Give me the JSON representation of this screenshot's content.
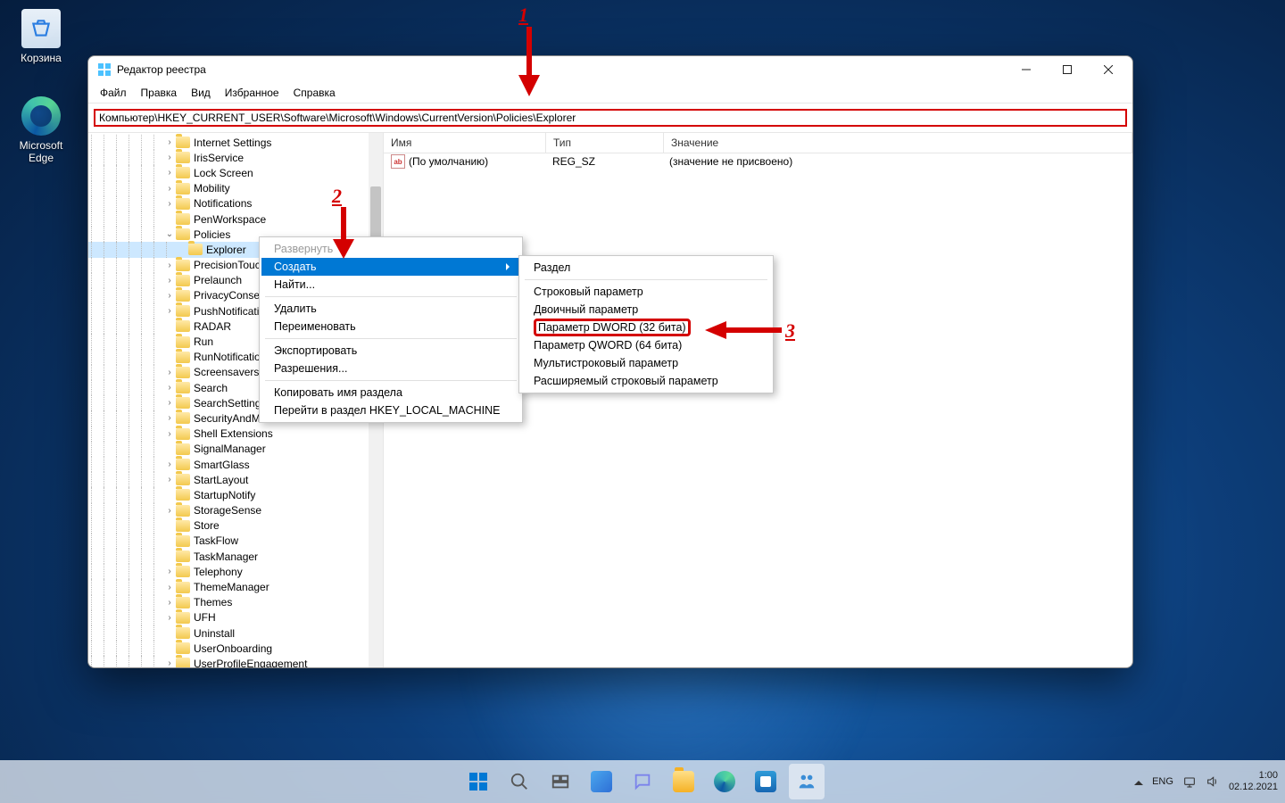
{
  "desktop_icons": [
    {
      "name": "recycle-bin",
      "label": "Корзина"
    },
    {
      "name": "edge",
      "label": "Microsoft Edge"
    }
  ],
  "window": {
    "title": "Редактор реестра",
    "menu": [
      "Файл",
      "Правка",
      "Вид",
      "Избранное",
      "Справка"
    ],
    "address": "Компьютер\\HKEY_CURRENT_USER\\Software\\Microsoft\\Windows\\CurrentVersion\\Policies\\Explorer",
    "controls": {
      "min": "—",
      "max": "☐",
      "close": "✕"
    }
  },
  "tree": [
    {
      "d": 6,
      "e": ">",
      "l": "Internet Settings"
    },
    {
      "d": 6,
      "e": ">",
      "l": "IrisService"
    },
    {
      "d": 6,
      "e": ">",
      "l": "Lock Screen"
    },
    {
      "d": 6,
      "e": ">",
      "l": "Mobility"
    },
    {
      "d": 6,
      "e": ">",
      "l": "Notifications"
    },
    {
      "d": 6,
      "e": "",
      "l": "PenWorkspace"
    },
    {
      "d": 6,
      "e": "v",
      "l": "Policies"
    },
    {
      "d": 7,
      "e": "",
      "l": "Explorer",
      "sel": true
    },
    {
      "d": 6,
      "e": ">",
      "l": "PrecisionTouchPad"
    },
    {
      "d": 6,
      "e": ">",
      "l": "Prelaunch"
    },
    {
      "d": 6,
      "e": ">",
      "l": "PrivacyConsent"
    },
    {
      "d": 6,
      "e": ">",
      "l": "PushNotifications"
    },
    {
      "d": 6,
      "e": "",
      "l": "RADAR"
    },
    {
      "d": 6,
      "e": "",
      "l": "Run"
    },
    {
      "d": 6,
      "e": "",
      "l": "RunNotification"
    },
    {
      "d": 6,
      "e": ">",
      "l": "Screensavers"
    },
    {
      "d": 6,
      "e": ">",
      "l": "Search"
    },
    {
      "d": 6,
      "e": ">",
      "l": "SearchSettings"
    },
    {
      "d": 6,
      "e": ">",
      "l": "SecurityAndMaintenance"
    },
    {
      "d": 6,
      "e": ">",
      "l": "Shell Extensions"
    },
    {
      "d": 6,
      "e": "",
      "l": "SignalManager"
    },
    {
      "d": 6,
      "e": ">",
      "l": "SmartGlass"
    },
    {
      "d": 6,
      "e": ">",
      "l": "StartLayout"
    },
    {
      "d": 6,
      "e": "",
      "l": "StartupNotify"
    },
    {
      "d": 6,
      "e": ">",
      "l": "StorageSense"
    },
    {
      "d": 6,
      "e": "",
      "l": "Store"
    },
    {
      "d": 6,
      "e": "",
      "l": "TaskFlow"
    },
    {
      "d": 6,
      "e": "",
      "l": "TaskManager"
    },
    {
      "d": 6,
      "e": ">",
      "l": "Telephony"
    },
    {
      "d": 6,
      "e": ">",
      "l": "ThemeManager"
    },
    {
      "d": 6,
      "e": ">",
      "l": "Themes"
    },
    {
      "d": 6,
      "e": ">",
      "l": "UFH"
    },
    {
      "d": 6,
      "e": "",
      "l": "Uninstall"
    },
    {
      "d": 6,
      "e": "",
      "l": "UserOnboarding"
    },
    {
      "d": 6,
      "e": ">",
      "l": "UserProfileEngagement"
    }
  ],
  "list": {
    "headers": {
      "name": "Имя",
      "type": "Тип",
      "value": "Значение"
    },
    "rows": [
      {
        "name": "(По умолчанию)",
        "type": "REG_SZ",
        "value": "(значение не присвоено)"
      }
    ]
  },
  "ctx1": [
    {
      "t": "Развернуть",
      "dis": true
    },
    {
      "t": "Создать",
      "hl": true,
      "sub": true
    },
    {
      "t": "Найти...",
      "after_sep": true
    },
    {
      "t": "Удалить"
    },
    {
      "t": "Переименовать",
      "after_sep": true
    },
    {
      "t": "Экспортировать"
    },
    {
      "t": "Разрешения...",
      "after_sep": true
    },
    {
      "t": "Копировать имя раздела"
    },
    {
      "t": "Перейти в раздел HKEY_LOCAL_MACHINE"
    }
  ],
  "ctx2": [
    {
      "t": "Раздел",
      "after_sep": true
    },
    {
      "t": "Строковый параметр"
    },
    {
      "t": "Двоичный параметр"
    },
    {
      "t": "Параметр DWORD (32 бита)",
      "boxed": true
    },
    {
      "t": "Параметр QWORD (64 бита)"
    },
    {
      "t": "Мультистроковый параметр"
    },
    {
      "t": "Расширяемый строковый параметр"
    }
  ],
  "anno": {
    "n1": "1",
    "n2": "2",
    "n3": "3"
  },
  "tray": {
    "lang": "ENG",
    "time": "1:00",
    "date": "02.12.2021"
  }
}
